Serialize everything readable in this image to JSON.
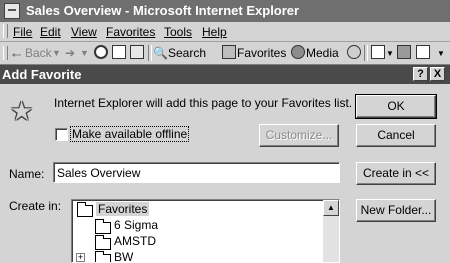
{
  "browser": {
    "title": "Sales Overview - Microsoft Internet Explorer",
    "menu": [
      "File",
      "Edit",
      "View",
      "Favorites",
      "Tools",
      "Help"
    ],
    "toolbar": {
      "back": "Back",
      "search": "Search",
      "favorites": "Favorites",
      "media": "Media"
    }
  },
  "dialog": {
    "title": "Add Favorite",
    "message": "Internet Explorer will add this page to your Favorites list.",
    "offline_label": "Make available offline",
    "offline_checked": false,
    "name_label": "Name:",
    "name_value": "Sales Overview",
    "create_in_label": "Create in:",
    "buttons": {
      "ok": "OK",
      "cancel": "Cancel",
      "customize": "Customize...",
      "create_in": "Create in <<",
      "new_folder": "New Folder..."
    },
    "title_buttons": {
      "help": "?",
      "close": "X"
    },
    "tree": [
      {
        "label": "Favorites",
        "expander": ""
      },
      {
        "label": "6 Sigma",
        "expander": ""
      },
      {
        "label": "AMSTD",
        "expander": ""
      },
      {
        "label": "BW",
        "expander": "+"
      }
    ]
  }
}
